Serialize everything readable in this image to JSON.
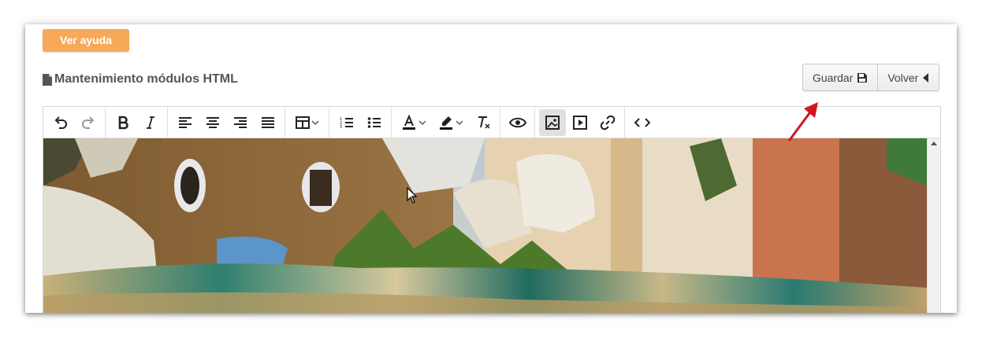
{
  "help_button": {
    "label": "Ver ayuda"
  },
  "page": {
    "title": "Mantenimiento módulos HTML"
  },
  "actions": {
    "save_label": "Guardar",
    "back_label": "Volver"
  },
  "toolbar": {
    "groups": [
      [
        "undo-icon",
        "redo-icon"
      ],
      [
        "bold-icon",
        "italic-icon"
      ],
      [
        "align-left-icon",
        "align-center-icon",
        "align-right-icon",
        "align-justify-icon"
      ],
      [
        "table-icon"
      ],
      [
        "numbered-list-icon",
        "bullet-list-icon"
      ],
      [
        "text-color-icon",
        "highlight-color-icon",
        "clear-formatting-icon"
      ],
      [
        "preview-icon"
      ],
      [
        "image-icon",
        "media-icon",
        "link-icon"
      ],
      [
        "source-code-icon"
      ]
    ],
    "active": "image-icon"
  },
  "colors": {
    "help_button_bg": "#f7a859",
    "annotation_arrow": "#d0161c"
  }
}
